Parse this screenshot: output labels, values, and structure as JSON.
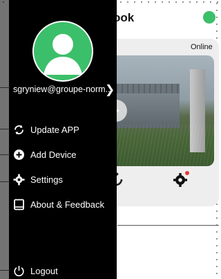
{
  "app": {
    "title": "Glook"
  },
  "device": {
    "status": "Online",
    "alert_color": "#e53935"
  },
  "drawer": {
    "email": "sgryniew@groupe-norm...",
    "items": [
      {
        "label": "Update APP",
        "icon": "refresh-icon"
      },
      {
        "label": "Add Device",
        "icon": "add-device-icon"
      },
      {
        "label": "Settings",
        "icon": "gear-icon"
      },
      {
        "label": "About & Feedback",
        "icon": "book-icon"
      },
      {
        "label": "Logout",
        "icon": "power-icon"
      }
    ]
  },
  "colors": {
    "accent": "#3cbf6a",
    "drawer_bg": "#000000"
  }
}
